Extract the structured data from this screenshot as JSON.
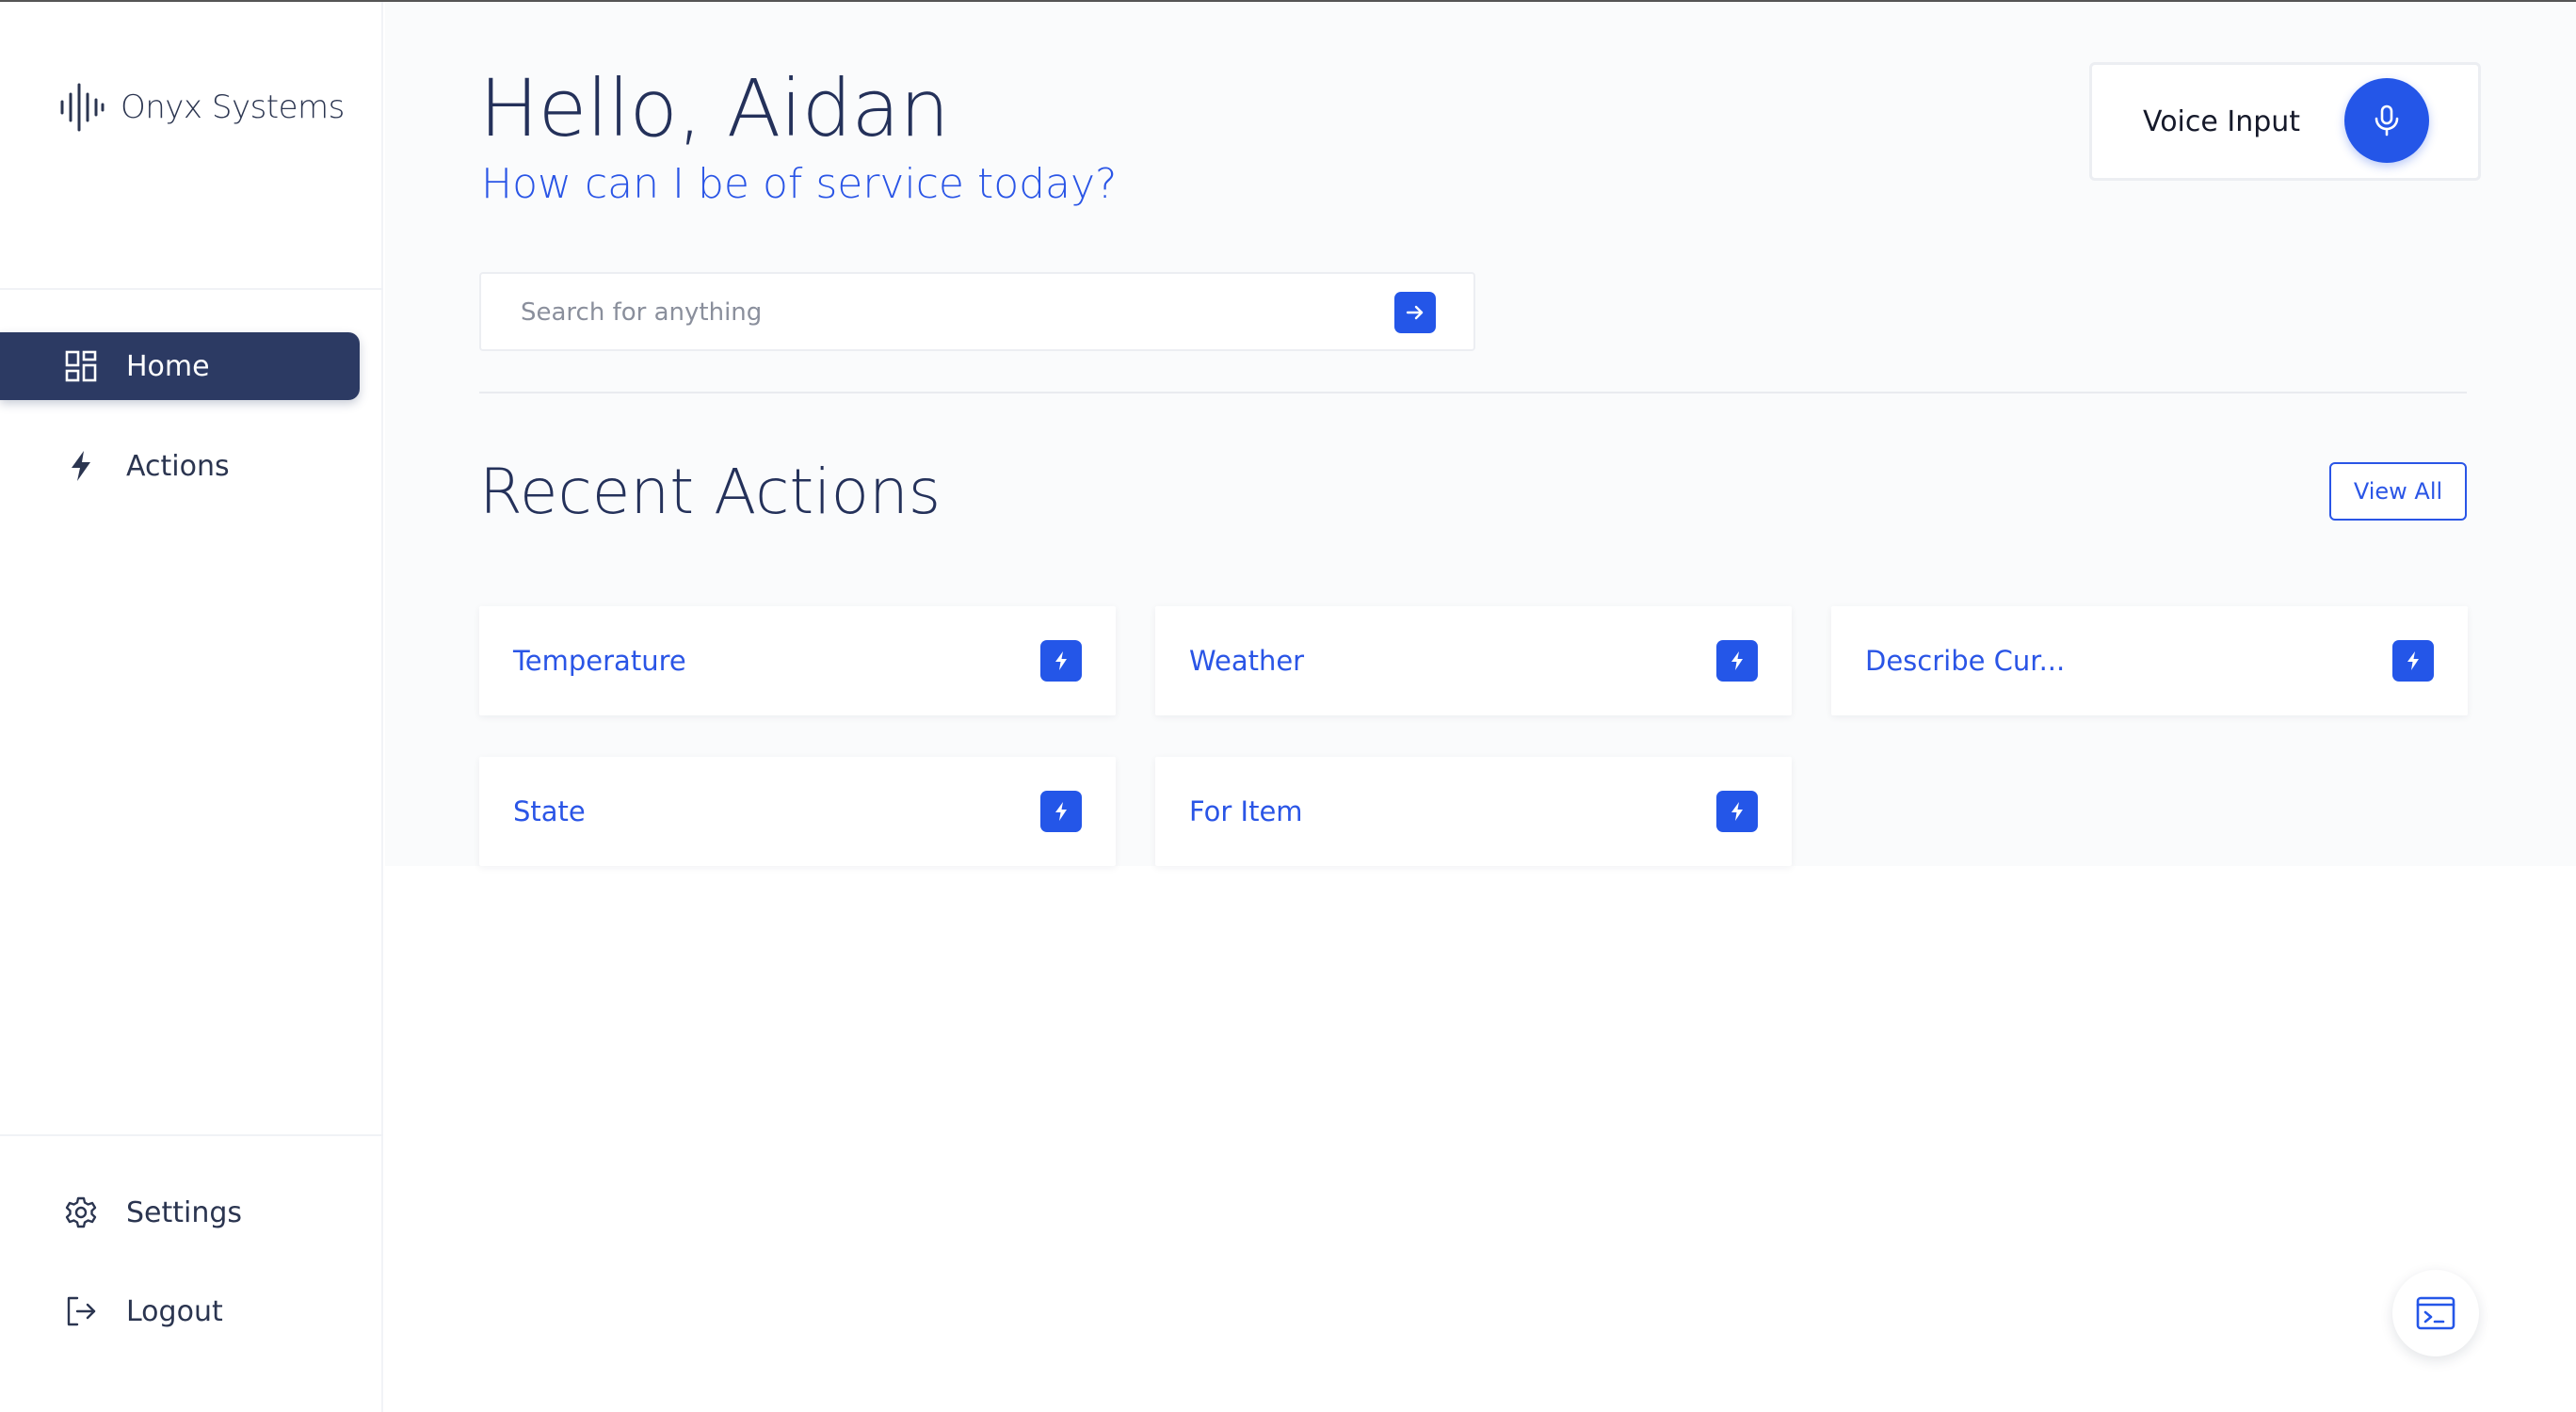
{
  "brand": {
    "name": "Onyx Systems",
    "icon": "soundwave-icon"
  },
  "sidebar": {
    "items": [
      {
        "label": "Home",
        "icon": "grid-icon",
        "active": true
      },
      {
        "label": "Actions",
        "icon": "lightning-icon",
        "active": false
      }
    ],
    "bottom_items": [
      {
        "label": "Settings",
        "icon": "gear-icon"
      },
      {
        "label": "Logout",
        "icon": "logout-icon"
      }
    ]
  },
  "header": {
    "greeting": "Hello, Aidan",
    "subtitle": "How can I be of service today?"
  },
  "voice": {
    "label": "Voice Input",
    "icon": "microphone-icon"
  },
  "search": {
    "placeholder": "Search for anything",
    "value": "",
    "icon": "arrow-right-icon"
  },
  "recent": {
    "title": "Recent Actions",
    "view_all_label": "View All",
    "actions": [
      {
        "label": "Temperature",
        "icon": "lightning-icon"
      },
      {
        "label": "Weather",
        "icon": "lightning-icon"
      },
      {
        "label": "Describe Cur...",
        "icon": "lightning-icon"
      },
      {
        "label": "State",
        "icon": "lightning-icon"
      },
      {
        "label": "For Item",
        "icon": "lightning-icon"
      }
    ]
  },
  "fab": {
    "icon": "terminal-icon"
  },
  "colors": {
    "accent": "#2456e8",
    "nav_active": "#2c3a63",
    "heading": "#24315a",
    "background": "#fafbfc"
  }
}
